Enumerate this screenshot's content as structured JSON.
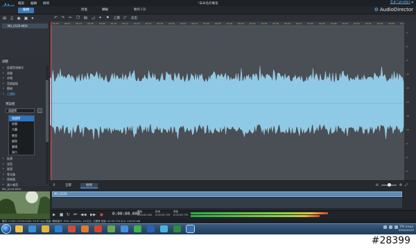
{
  "app": {
    "window_title": "*未命名的專案",
    "brand": "AudioDirector",
    "signin_link": "登入 CyberLink",
    "menu": [
      "檔案",
      "編輯",
      "檢視"
    ],
    "top_tabs": [
      "編輯",
      "修復",
      "轉輸",
      "製作 CD"
    ]
  },
  "left_toolbar": {
    "icons": [
      "import-icon",
      "music-icon",
      "cd-icon",
      "video-icon",
      "settings-icon"
    ]
  },
  "edit_toolbar": {
    "icons": [
      "undo-icon",
      "redo-icon",
      "cut-icon",
      "copy-icon",
      "paste-icon",
      "fade-icon",
      "effect-icon",
      "marker-icon",
      "normalize-icon"
    ],
    "volume_up_label": "上揚",
    "volume_down_label": "淡出"
  },
  "library": {
    "file": "MV_0129.MOV"
  },
  "effects": {
    "header": "調整",
    "items": [
      "延遲音效樣式",
      "迴聲",
      "合唱",
      "音調變換",
      "壓縮",
      "已選取"
    ],
    "preset_label": "預設組",
    "preset_value": "請選擇",
    "dropdown_options": [
      "請選擇",
      "房間",
      "大廳",
      "教堂",
      "劇院",
      "廣場",
      "洞穴"
    ],
    "dropdown_selected": 0,
    "items2": [
      "延遲",
      "混音",
      "變速",
      "等化器",
      "限制器",
      "減少噪音",
      "音調校正器"
    ]
  },
  "preview": {
    "file": "MV_0129.MOV"
  },
  "ruler": {
    "ticks": [
      "00:00",
      "00:02",
      "00:04",
      "00:06",
      "00:08",
      "00:10",
      "00:12",
      "00:14",
      "00:16",
      "00:18",
      "00:20",
      "00:22",
      "00:24",
      "00:26",
      "00:28",
      "00:30",
      "00:32",
      "00:34",
      "00:36",
      "00:38",
      "00:40",
      "00:42",
      "00:44",
      "00:46",
      "00:48",
      "00:50",
      "00:52",
      "00:54",
      "00:56",
      "00:58",
      "01:00"
    ]
  },
  "vruler": {
    "ticks": [
      "-3",
      "-6",
      "-9",
      "-12",
      "-18",
      "-inf",
      "-18",
      "-12",
      "-9",
      "-6",
      "-3"
    ]
  },
  "wave_tabs": [
    "全部",
    "檢視"
  ],
  "track": {
    "name": "MV_0129"
  },
  "transport": {
    "timecode": "0:00:00.000",
    "info_labels": [
      "開始",
      "結束",
      "長度"
    ],
    "info_values": [
      "0:00:00.000",
      "0:00:59.733",
      "0:00:59.733"
    ],
    "level_left": 0.62,
    "level_right": 0.58
  },
  "status": "格式: H.264 (1920x1080, 29.97 fps) 角度: 轉換格式: PCM, 44100Hz, 16 位元, 立體聲  長度: 00:59.733  大小: 126.90 MB",
  "taskbar": {
    "clock_time": "下午 03:44",
    "clock_date": "2014/10/15",
    "apps": [
      "explorer",
      "media",
      "folder",
      "ie",
      "browser",
      "firefox",
      "powerpoint",
      "paint",
      "chrome",
      "chrome2",
      "word",
      "chrome3",
      "excel",
      "audiodirector"
    ]
  },
  "colors": {
    "accent": "#3a7bbf",
    "wave": "#8ec9e6",
    "playhead": "#e03838"
  },
  "watermark": "#28399"
}
